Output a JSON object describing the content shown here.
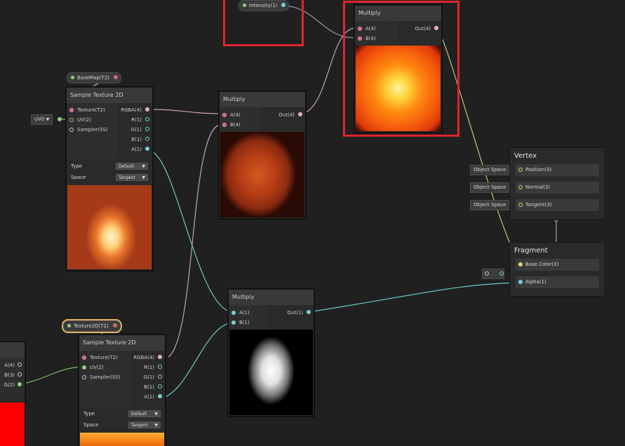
{
  "colors": {
    "canvas": "#202020",
    "node": "#2a2a2a",
    "highlight": "#e0252c",
    "wire_pink": "#c9a2b9",
    "wire_teal": "#6fc7c7",
    "wire_green": "#7fbf6b",
    "wire_yellow": "#c8c27a"
  },
  "property_nodes": {
    "intensity": "Intensity(1)",
    "basemap": "BaseMap(T2)",
    "texture2d": "Texture2D(T2)"
  },
  "uv_chip": {
    "label": "UV0"
  },
  "sample1": {
    "title": "Sample Texture 2D",
    "inputs": [
      "Texture(T2)",
      "UV(2)",
      "Sampler(SS)"
    ],
    "outputs": [
      "RGBA(4)",
      "R(1)",
      "G(1)",
      "B(1)",
      "A(1)"
    ],
    "type_label": "Type",
    "type_value": "Default",
    "space_label": "Space",
    "space_value": "Tangent"
  },
  "sample2": {
    "title": "Sample Texture 2D",
    "inputs": [
      "Texture(T2)",
      "UV(2)",
      "Sampler(SS)"
    ],
    "outputs": [
      "RGBA(4)",
      "R(1)",
      "G(1)",
      "B(1)",
      "A(1)"
    ],
    "type_label": "Type",
    "type_value": "Default",
    "space_label": "Space",
    "space_value": "Tangent"
  },
  "multiply_top": {
    "title": "Multiply",
    "inputs": [
      "A(4)",
      "B(4)"
    ],
    "output": "Out(4)"
  },
  "multiply_mid": {
    "title": "Multiply",
    "inputs": [
      "A(4)",
      "B(4)"
    ],
    "output": "Out(4)"
  },
  "multiply_alpha": {
    "title": "Multiply",
    "inputs": [
      "A(1)",
      "B(1)"
    ],
    "output": "Out(1)"
  },
  "left_partial": {
    "outputs": [
      "A(4)",
      "B(3)",
      "G(2)"
    ]
  },
  "vertex": {
    "title": "Vertex",
    "rows": [
      {
        "chip": "Object Space",
        "label": "Position(3)"
      },
      {
        "chip": "Object Space",
        "label": "Normal(3)"
      },
      {
        "chip": "Object Space",
        "label": "Tangent(3)"
      }
    ]
  },
  "fragment": {
    "title": "Fragment",
    "rows": [
      {
        "label": "Base Color(3)"
      },
      {
        "label": "Alpha(1)"
      }
    ]
  }
}
